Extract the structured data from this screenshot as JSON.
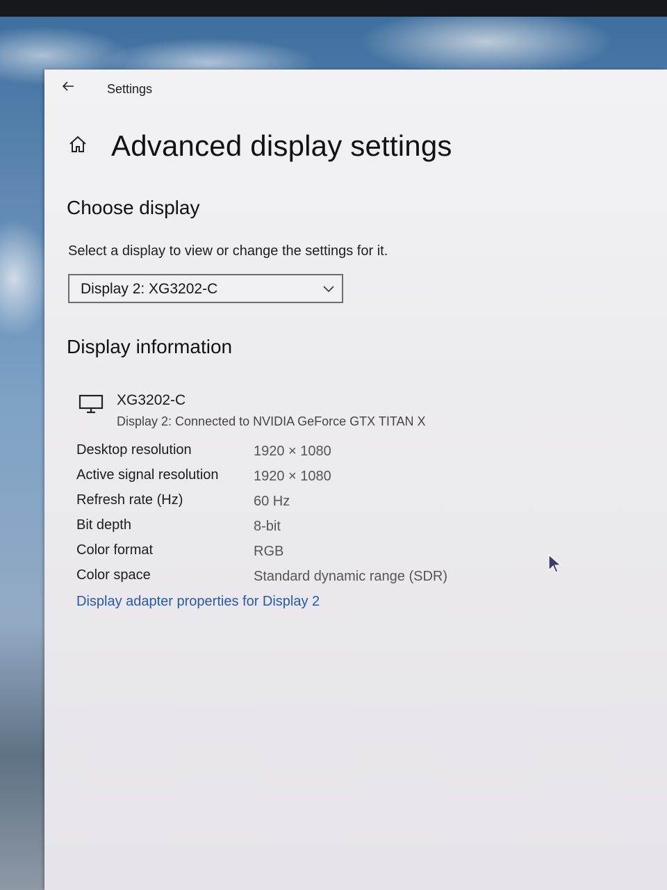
{
  "window": {
    "app_title": "Settings",
    "page_title": "Advanced display settings"
  },
  "choose_display": {
    "heading": "Choose display",
    "prompt": "Select a display to view or change the settings for it.",
    "selected": "Display 2: XG3202-C"
  },
  "display_information": {
    "heading": "Display information",
    "monitor_name": "XG3202-C",
    "connection": "Display 2: Connected to NVIDIA GeForce GTX TITAN X",
    "rows": [
      {
        "label": "Desktop resolution",
        "value": "1920 × 1080"
      },
      {
        "label": "Active signal resolution",
        "value": "1920 × 1080"
      },
      {
        "label": "Refresh rate (Hz)",
        "value": "60 Hz"
      },
      {
        "label": "Bit depth",
        "value": "8-bit"
      },
      {
        "label": "Color format",
        "value": "RGB"
      },
      {
        "label": "Color space",
        "value": "Standard dynamic range (SDR)"
      }
    ],
    "adapter_link": "Display adapter properties for Display 2"
  },
  "icons": {
    "back": "back-arrow-icon",
    "home": "home-icon",
    "dropdown": "chevron-down-icon",
    "monitor": "monitor-icon",
    "cursor": "mouse-cursor-icon"
  }
}
